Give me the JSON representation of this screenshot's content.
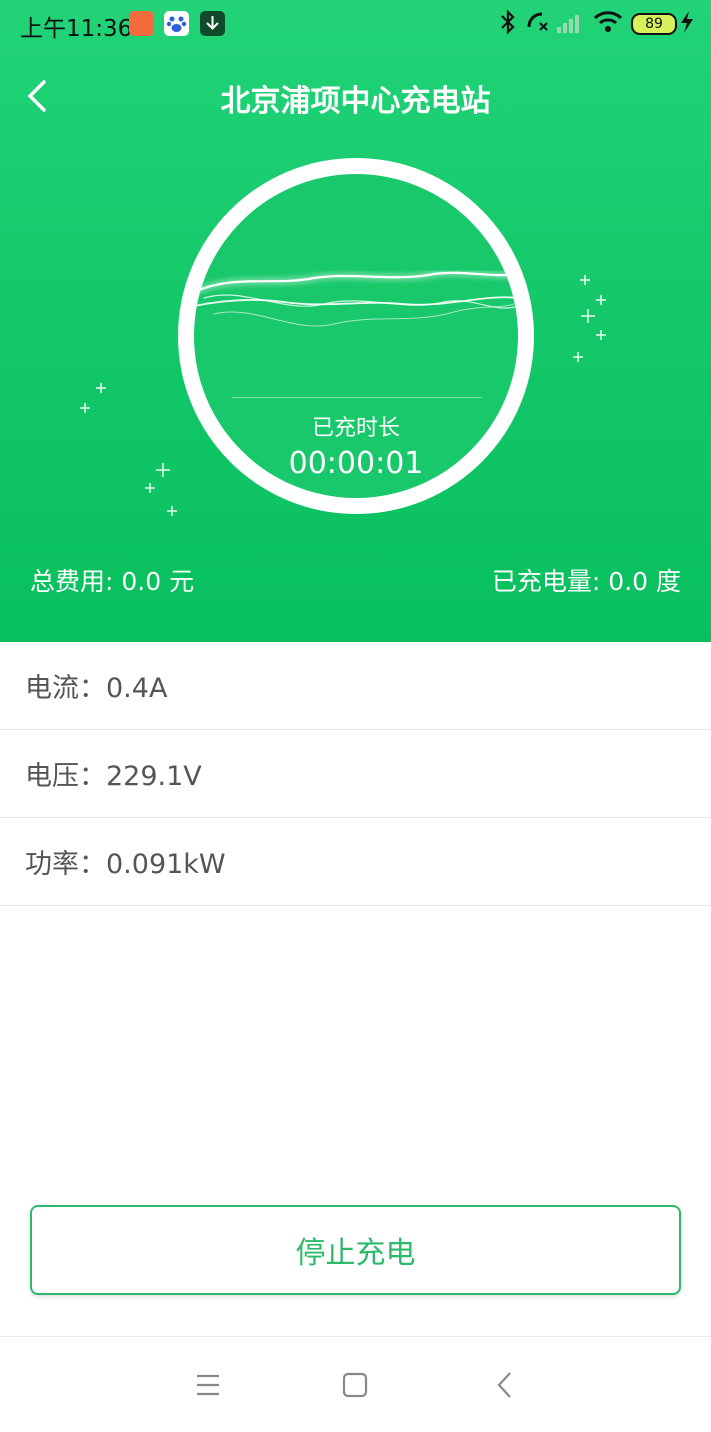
{
  "status_bar": {
    "time": "上午11:36",
    "battery_level": "89",
    "icons": [
      "app-notification-icon",
      "baidu-paw-icon",
      "download-icon",
      "bluetooth-icon",
      "call-missed-icon",
      "signal-icon",
      "wifi-icon",
      "battery-icon",
      "charging-bolt-icon"
    ]
  },
  "header": {
    "title": "北京浦项中心充电站",
    "back_icon": "chevron-left-icon"
  },
  "charging": {
    "duration_label": "已充时长",
    "duration_value": "00:00:01",
    "total_fee": "总费用: 0.0 元",
    "energy_charged": "已充电量: 0.0 度"
  },
  "metrics": [
    {
      "text": "电流：0.4A"
    },
    {
      "text": "电压：229.1V"
    },
    {
      "text": "功率：0.091kW"
    }
  ],
  "actions": {
    "stop_label": "停止充电"
  },
  "colors": {
    "brand_green": "#12c768",
    "button_green": "#2fb96a"
  },
  "system_nav": {
    "icons": [
      "menu-icon",
      "home-icon",
      "back-icon"
    ]
  }
}
